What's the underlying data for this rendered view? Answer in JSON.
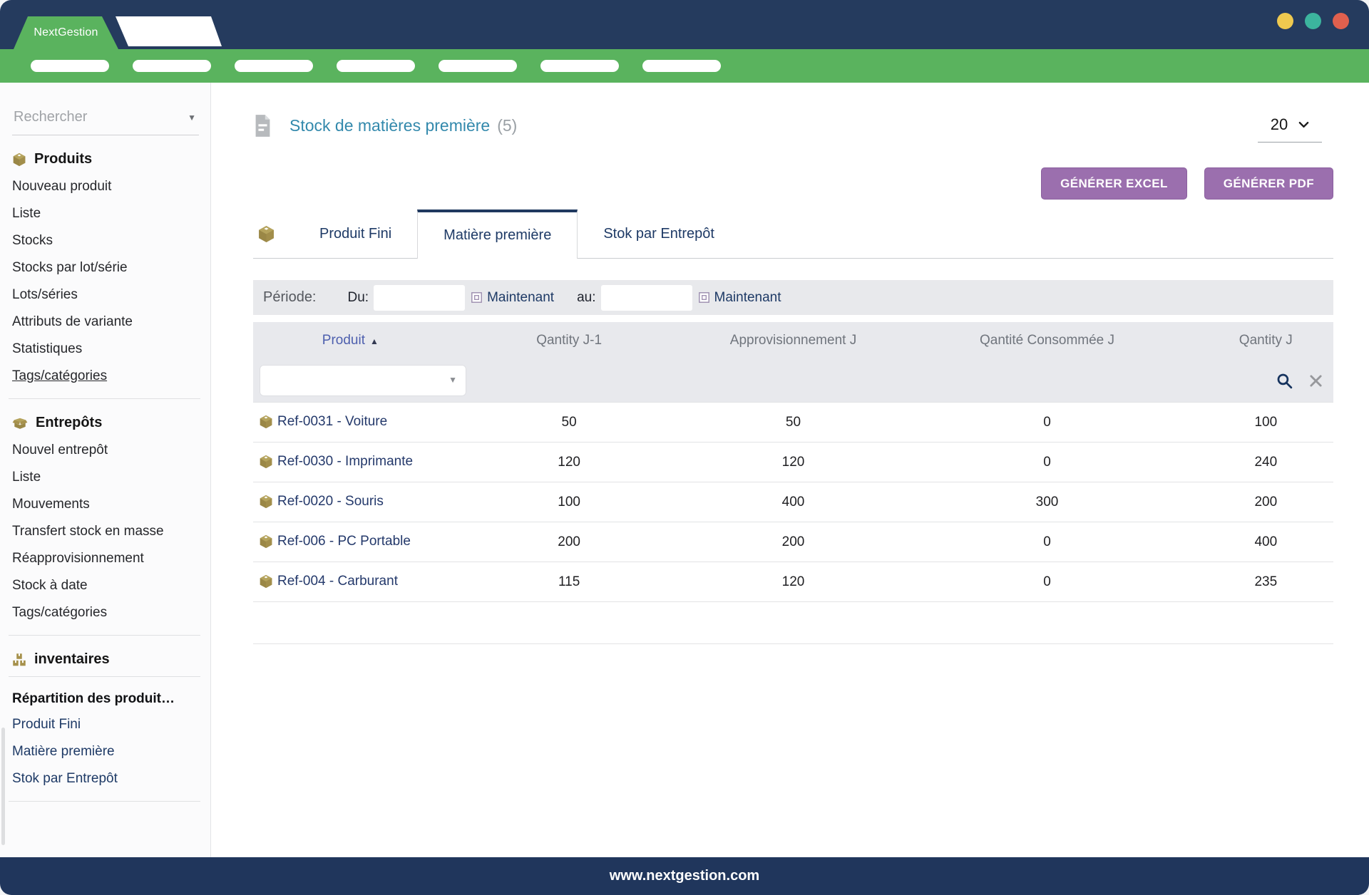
{
  "window": {
    "brand": "NextGestion",
    "footer": "www.nextgestion.com"
  },
  "navbar": {
    "pills": 7
  },
  "sidebar": {
    "search": {
      "placeholder": "Rechercher"
    },
    "sections": [
      {
        "icon": "box-icon",
        "title": "Produits",
        "items": [
          {
            "label": "Nouveau produit"
          },
          {
            "label": "Liste"
          },
          {
            "label": "Stocks"
          },
          {
            "label": "Stocks par lot/série"
          },
          {
            "label": "Lots/séries"
          },
          {
            "label": "Attributs de variante"
          },
          {
            "label": "Statistiques"
          },
          {
            "label": "Tags/catégories",
            "underlined": true
          }
        ]
      },
      {
        "icon": "open-box-icon",
        "title": "Entrepôts",
        "items": [
          {
            "label": "Nouvel entrepôt"
          },
          {
            "label": "Liste"
          },
          {
            "label": "Mouvements"
          },
          {
            "label": "Transfert stock en masse"
          },
          {
            "label": "Réapprovisionnement"
          },
          {
            "label": "Stock à date"
          },
          {
            "label": "Tags/catégories"
          }
        ]
      },
      {
        "icon": "stacked-boxes-icon",
        "title": "inventaires",
        "items": []
      }
    ],
    "report_group": {
      "title": "Répartition des produit…",
      "items": [
        {
          "label": "Produit Fini"
        },
        {
          "label": "Matière première"
        },
        {
          "label": "Stok par Entrepôt"
        }
      ]
    }
  },
  "main": {
    "title": "Stock de matières première",
    "count": "(5)",
    "page_size": "20",
    "generate_excel": "GÉNÉRER EXCEL",
    "generate_pdf": "GÉNÉRER PDF",
    "tabs": [
      {
        "label": "Produit Fini"
      },
      {
        "label": "Matière première",
        "active": true
      },
      {
        "label": "Stok par Entrepôt"
      }
    ],
    "periode": {
      "label": "Période:",
      "du": "Du:",
      "au": "au:",
      "now": "Maintenant"
    },
    "table": {
      "columns": [
        {
          "label": "Produit",
          "sort": "asc"
        },
        {
          "label": "Qantity J-1"
        },
        {
          "label": "Approvisionnement J"
        },
        {
          "label": "Qantité Consommée J"
        },
        {
          "label": "Qantity J"
        }
      ],
      "rows": [
        {
          "produit": "Ref-0031 - Voiture",
          "values": [
            "50",
            "50",
            "0",
            "100"
          ]
        },
        {
          "produit": "Ref-0030 - Imprimante",
          "values": [
            "120",
            "120",
            "0",
            "240"
          ]
        },
        {
          "produit": "Ref-0020 - Souris",
          "values": [
            "100",
            "400",
            "300",
            "200"
          ]
        },
        {
          "produit": "Ref-006 - PC Portable",
          "values": [
            "200",
            "200",
            "0",
            "400"
          ]
        },
        {
          "produit": "Ref-004 - Carburant",
          "values": [
            "115",
            "120",
            "0",
            "235"
          ]
        }
      ]
    }
  },
  "colors": {
    "topbar_navy": "#253b5e",
    "green": "#5ab35e",
    "button_purple": "#9b6fae",
    "title_teal": "#3389ac",
    "navy_text": "#1e3a66",
    "gold": "#a6914c",
    "dot_yellow": "#efc94f",
    "dot_teal": "#3cb49e",
    "dot_red": "#e0604e"
  }
}
